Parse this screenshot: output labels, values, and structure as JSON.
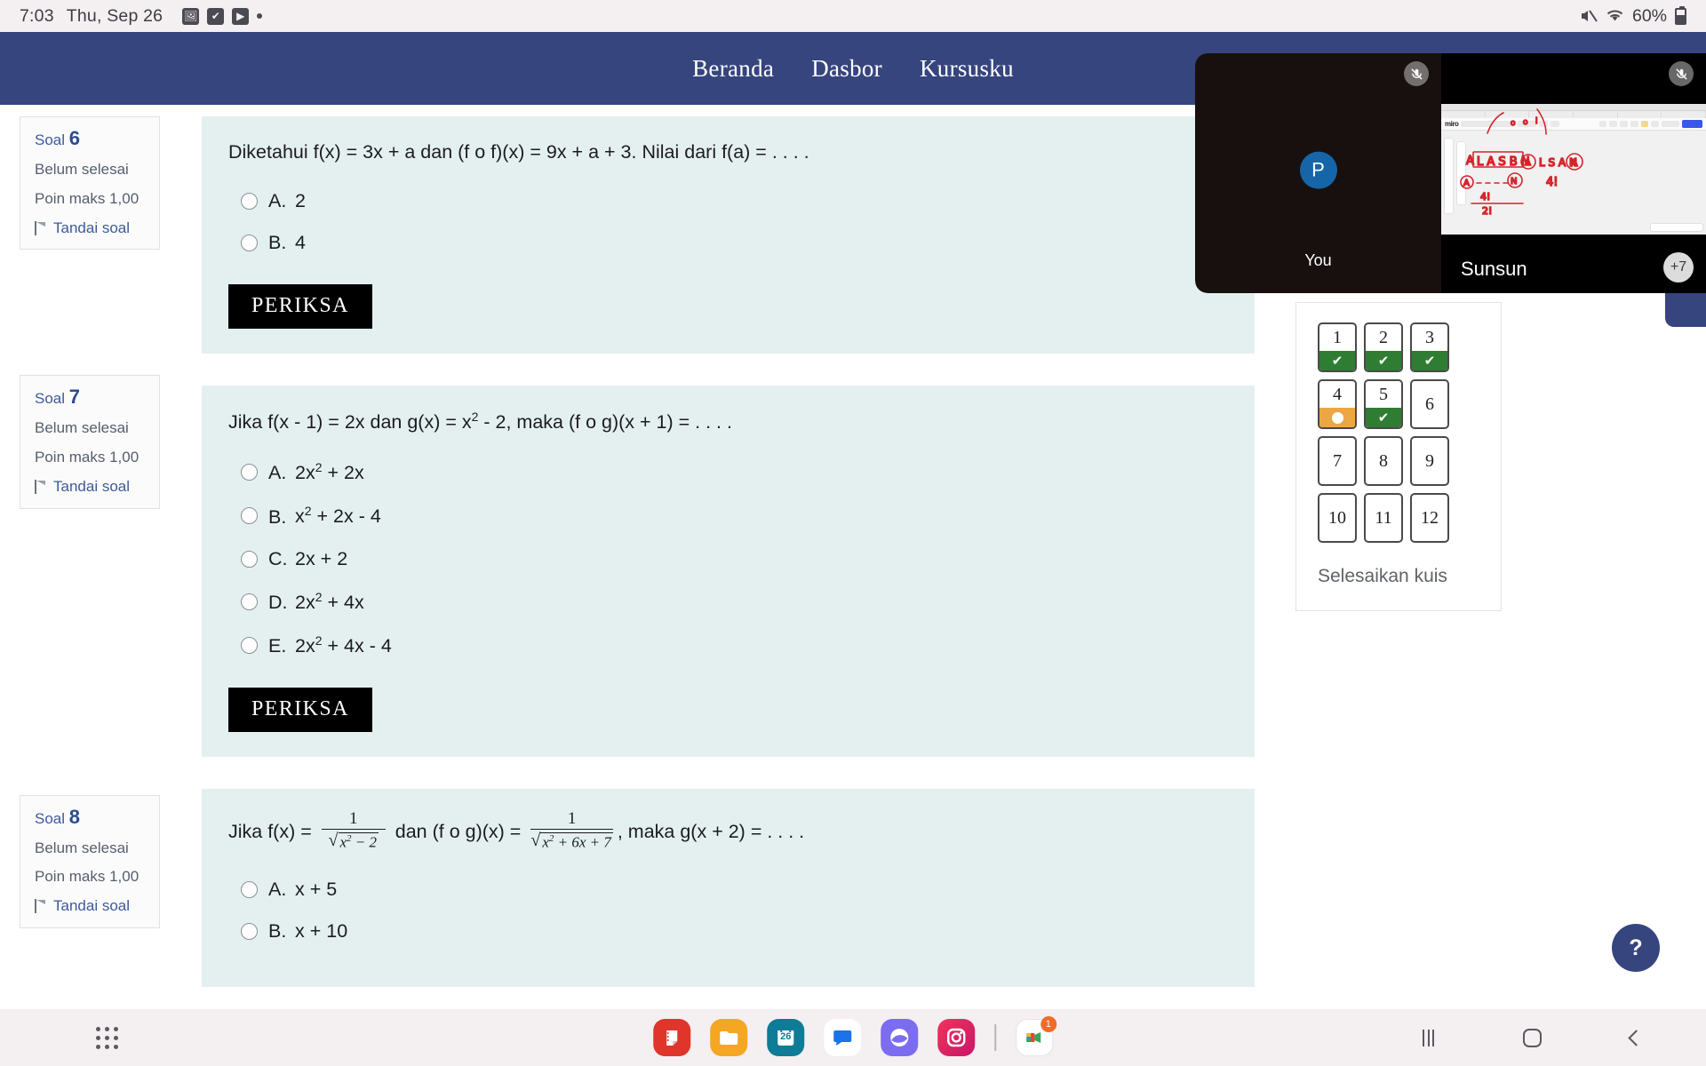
{
  "statusbar": {
    "time": "7:03",
    "date": "Thu, Sep 26",
    "icons": [
      "image-icon",
      "checkbox-icon",
      "youtube-icon",
      "more-dot-icon"
    ],
    "mute_icon": "mute-icon",
    "wifi_icon": "wifi-icon",
    "battery_percent": "60%"
  },
  "topnav": {
    "items": [
      {
        "label": "Beranda"
      },
      {
        "label": "Dasbor"
      },
      {
        "label": "Kursusku"
      }
    ]
  },
  "questions": [
    {
      "info": {
        "soal_label": "Soal",
        "number": "6",
        "status": "Belum selesai",
        "points": "Poin maks 1,00",
        "flag": "Tandai soal"
      },
      "prompt_parts": [
        {
          "t": "Diketahui f(x) = 3x + a dan (f o f)(x) = 9x + a + 3. Nilai dari f(a) = . . . ."
        }
      ],
      "answers": [
        {
          "letter": "A.",
          "text": "2"
        },
        {
          "letter": "B.",
          "text": "4"
        }
      ],
      "check_label": "PERIKSA"
    },
    {
      "info": {
        "soal_label": "Soal",
        "number": "7",
        "status": "Belum selesai",
        "points": "Poin maks 1,00",
        "flag": "Tandai soal"
      },
      "prompt_parts": [
        {
          "t": "Jika f(x - 1) = 2x dan g(x) = x"
        },
        {
          "sup": "2"
        },
        {
          "t": " - 2, maka (f o g)(x + 1) = . . . ."
        }
      ],
      "answers": [
        {
          "letter": "A.",
          "pre": "2x",
          "sup": "2",
          "post": " + 2x"
        },
        {
          "letter": "B.",
          "pre": "x",
          "sup": "2",
          "post": " + 2x - 4"
        },
        {
          "letter": "C.",
          "pre": "2x + 2",
          "sup": "",
          "post": ""
        },
        {
          "letter": "D.",
          "pre": "2x",
          "sup": "2",
          "post": " + 4x"
        },
        {
          "letter": "E.",
          "pre": "2x",
          "sup": "2",
          "post": " + 4x - 4"
        }
      ],
      "check_label": "PERIKSA"
    },
    {
      "info": {
        "soal_label": "Soal",
        "number": "8",
        "status": "Belum selesai",
        "points": "Poin maks 1,00",
        "flag": "Tandai soal"
      },
      "prompt_text_1": "Jika f(x) = ",
      "frac1": {
        "num": "1",
        "den_root": "x",
        "den_sup": "2",
        "den_rest": " − 2"
      },
      "prompt_text_2": " dan (f o g)(x) = ",
      "frac2": {
        "num": "1",
        "den_root": "x",
        "den_sup": "2",
        "den_rest": " + 6x + 7"
      },
      "prompt_text_3": ", maka g(x + 2) = . . . .",
      "answers": [
        {
          "letter": "A.",
          "text": "x + 5"
        },
        {
          "letter": "B.",
          "text": "x + 10"
        }
      ]
    }
  ],
  "navpanel": {
    "boxes": [
      {
        "n": "1",
        "state": "done"
      },
      {
        "n": "2",
        "state": "done"
      },
      {
        "n": "3",
        "state": "done"
      },
      {
        "n": "4",
        "state": "partial"
      },
      {
        "n": "5",
        "state": "done"
      },
      {
        "n": "6",
        "state": "none"
      },
      {
        "n": "7",
        "state": "none"
      },
      {
        "n": "8",
        "state": "none"
      },
      {
        "n": "9",
        "state": "none"
      },
      {
        "n": "10",
        "state": "none"
      },
      {
        "n": "11",
        "state": "none"
      },
      {
        "n": "12",
        "state": "none"
      }
    ],
    "finish_label": "Selesaikan kuis",
    "check_glyph": "✔",
    "done_color": "#2f7d32",
    "partial_color": "#eda644"
  },
  "help_button": {
    "label": "?"
  },
  "videocall": {
    "self_tile": {
      "avatar_letter": "P",
      "name": "You",
      "mic_icon": "mic-off-icon"
    },
    "share_tile": {
      "name": "Sunsun",
      "mic_icon": "mic-off-icon",
      "app_logo": "miro"
    },
    "overflow_badge": "+7"
  },
  "taskbar": {
    "apps_button": "app-grid-icon",
    "icons": [
      {
        "name": "samsung-notes-icon",
        "color": "#e0352b"
      },
      {
        "name": "my-files-icon",
        "color": "#f5a623"
      },
      {
        "name": "calendar-icon",
        "color": "#0e7c96",
        "label": "26"
      },
      {
        "name": "messages-icon",
        "color": "#ffffff"
      },
      {
        "name": "samsung-internet-icon",
        "color": "#7c6cf0"
      },
      {
        "name": "instagram-icon",
        "color": "#e0175b"
      },
      {
        "name": "divider",
        "color": ""
      },
      {
        "name": "google-meet-icon",
        "color": "#ffffff",
        "badge": "1"
      }
    ],
    "nav": [
      {
        "name": "recents-button"
      },
      {
        "name": "home-button"
      },
      {
        "name": "back-button"
      }
    ]
  }
}
